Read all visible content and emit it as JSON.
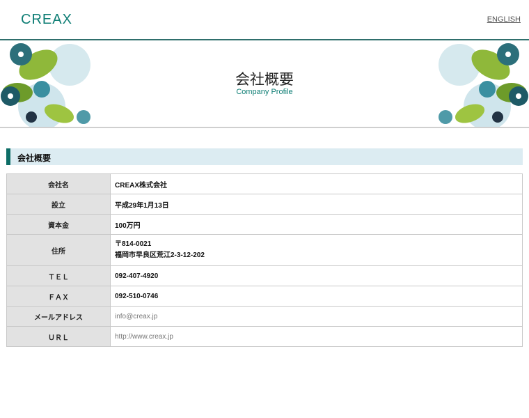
{
  "header": {
    "logo": "CREAX",
    "lang_link": "ENGLISH"
  },
  "banner": {
    "title": "会社概要",
    "subtitle": "Company Profile"
  },
  "section": {
    "heading": "会社概要"
  },
  "colors": {
    "brand": "#0d7d74",
    "accent_bar": "#0d6d66",
    "section_bg": "#dcecf2",
    "label_bg": "#e2e2e2"
  },
  "profile": {
    "rows": [
      {
        "label": "会社名",
        "value": "CREAX株式会社"
      },
      {
        "label": "設立",
        "value": "平成29年1月13日"
      },
      {
        "label": "資本金",
        "value": "100万円"
      },
      {
        "label": "住所",
        "value": "〒814-0021",
        "value2": "福岡市早良区荒江2-3-12-202"
      },
      {
        "label": "ＴＥＬ",
        "value": "092-407-4920"
      },
      {
        "label": "ＦＡＸ",
        "value": "092-510-0746"
      },
      {
        "label": "メールアドレス",
        "value": "info@creax.jp"
      },
      {
        "label": "ＵＲＬ",
        "value": "http://www.creax.jp"
      }
    ]
  }
}
